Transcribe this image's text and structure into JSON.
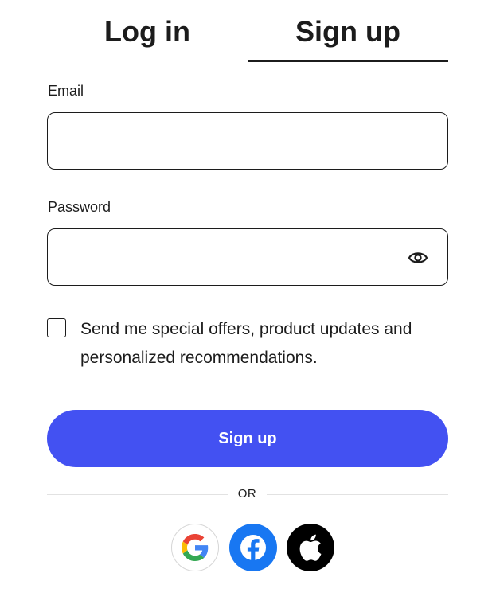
{
  "tabs": {
    "login": "Log in",
    "signup": "Sign up",
    "active": "signup"
  },
  "form": {
    "email_label": "Email",
    "email_value": "",
    "password_label": "Password",
    "password_value": "",
    "offers_checked": false,
    "offers_text": "Send me special offers, product updates and personalized recommendations.",
    "submit_label": "Sign up"
  },
  "divider": {
    "text": "OR"
  },
  "social": [
    {
      "name": "google-icon"
    },
    {
      "name": "facebook-icon"
    },
    {
      "name": "apple-icon"
    }
  ],
  "colors": {
    "primary": "#4351f2",
    "text": "#1c1c1c",
    "facebook": "#1877f2",
    "apple": "#000000"
  }
}
